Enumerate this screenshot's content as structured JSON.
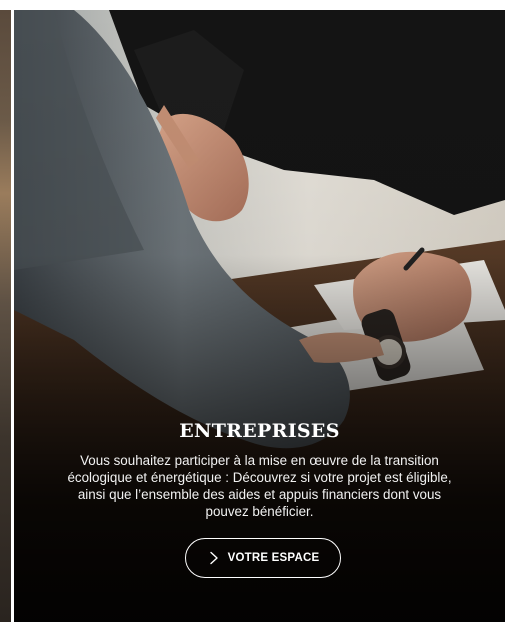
{
  "card": {
    "title": "ENTREPRISES",
    "description": "Vous souhaitez participer à la mise en œuvre de la transition écologique et énergétique : Découvrez si votre projet est éligible, ainsi que l’ensemble des aides et appuis financiers dont vous pouvez bénéficier.",
    "cta_label": "VOTRE ESPACE",
    "cta_icon": "chevron-right-icon",
    "text_color": "#ffffff"
  }
}
